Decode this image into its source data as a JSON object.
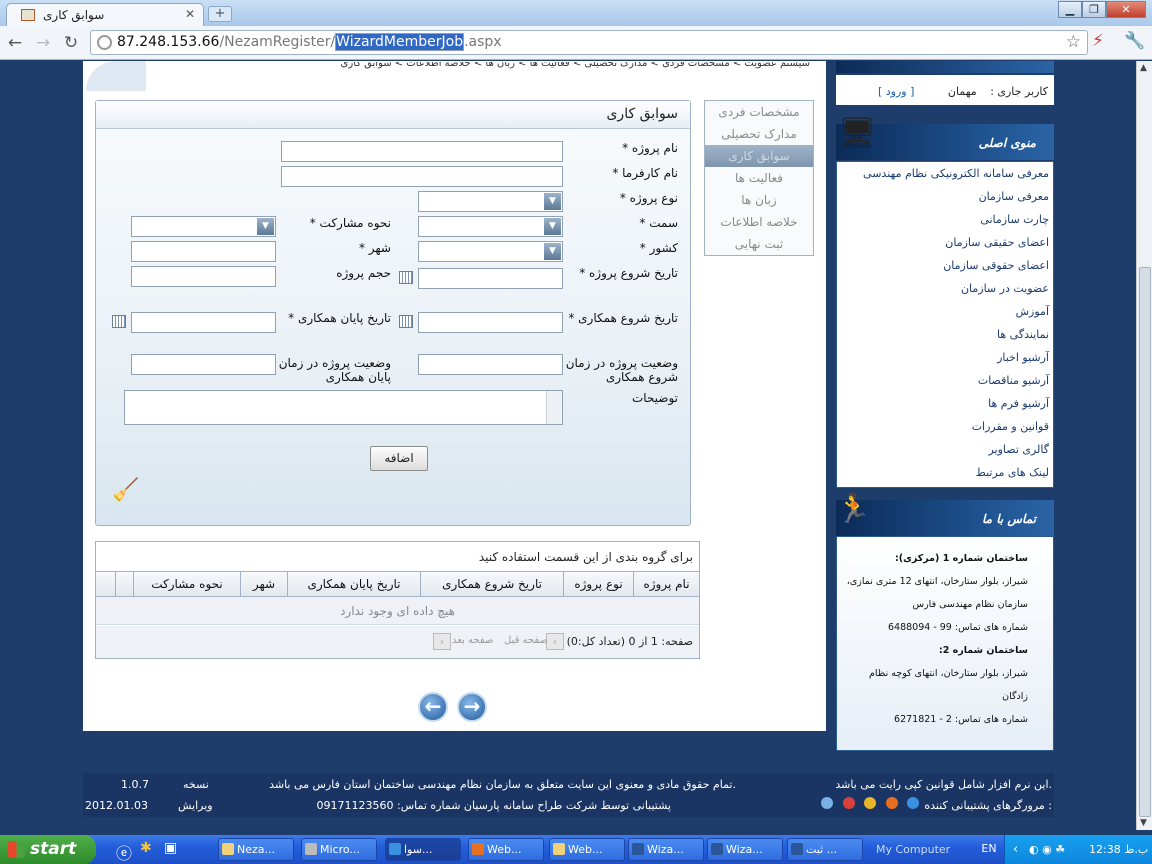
{
  "browser": {
    "tab_title": "سوابق کاری",
    "new_tab": "+",
    "url_host": "87.248.153.66",
    "url_path_pre": "/NezamRegister/",
    "url_selected": "WizardMemberJob",
    "url_ext": ".aspx",
    "win_min": "▁",
    "win_max": "❐",
    "win_close": "✕"
  },
  "breadcrumb": "سیستم عضویت > مشخصات فردی > مدارک تحصیلی > فعالیت ها > زبان ها > خلاصه اطلاعات > سوابق کاری",
  "wizard_steps": [
    "مشخصات فردی",
    "مدارک تحصیلی",
    "سوابق کاری",
    "فعالیت ها",
    "زبان ها",
    "خلاصه اطلاعات",
    "ثبت نهایی"
  ],
  "form": {
    "title": "سوابق کاری",
    "project_name": "نام پروژه *",
    "employer_name": "نام کارفرما *",
    "project_type": "نوع پروژه *",
    "position": "سمت *",
    "participation": "نحوه مشارکت *",
    "country": "کشور *",
    "city": "شهر *",
    "project_start": "تاریخ شروع پروژه *",
    "project_volume": "حجم پروژه",
    "coop_start": "تاریخ شروع همکاری *",
    "coop_end": "تاریخ پایان همکاری *",
    "status_start_1": "وضعیت پروژه در زمان",
    "status_start_2": "شروع همکاری",
    "status_end_1": "وضعیت پروژه در زمان",
    "status_end_2": "پایان همکاری",
    "description": "توضیحات",
    "add_button": "اضافه"
  },
  "grid": {
    "group_hint": "برای گروه بندی از این قسمت استفاده کنید",
    "columns": [
      "نام پروژه",
      "نوع پروژه",
      "تاریخ شروع همکاری",
      "تاریخ پایان همکاری",
      "شهر",
      "نحوه مشارکت"
    ],
    "no_data": "هیچ داده ای وجود ندارد",
    "pager_info": "صفحه: 1 از 0 (تعداد کل:0)",
    "prev_page": "صفحه قبل",
    "next_page": "صفحه بعد"
  },
  "user": {
    "label": "کاربر جاری :",
    "name": "مهمان",
    "login": "ورود"
  },
  "main_menu": {
    "title": "منوی اصلی",
    "items": [
      "معرفی سامانه الکترونیکی نظام مهندسی",
      "معرفی سازمان",
      "چارت سازمانی",
      "اعضای حقیقی سازمان",
      "اعضای حقوقی سازمان",
      "عضویت در سازمان",
      "آموزش",
      "نمایندگی ها",
      "آرشیو اخبار",
      "آرشیو مناقصات",
      "آرشیو فرم ها",
      "قوانین و مقررات",
      "گالری تصاویر",
      "لینک های مرتبط"
    ]
  },
  "contact": {
    "title": "تماس با ما",
    "b1_title": "ساختمان شماره 1 (مرکزی):",
    "b1_addr": "شیراز، بلوار ستارخان، انتهای 12 متری نمازی،",
    "b1_org": "سازمان نظام مهندسی فارس",
    "b1_phone": "شماره های تماس: 99 - 6488094",
    "b2_title": "ساختمان شماره 2:",
    "b2_addr": "شیراز، بلوار ستارخان، انتهای کوچه نظام زادگان",
    "b2_phone": "شماره های تماس: 2 - 6271821"
  },
  "footer": {
    "line1_right": "این نرم افزار شامل قوانین کپی رایت می باشد.",
    "line1_center": "تمام حقوق مادی و معنوی این سایت متعلق به سازمان نظام مهندسی ساختمان استان فارس می باشد.",
    "version_label": "نسخه",
    "version": "1.0.7",
    "line2_right": "مرورگرهای پشتیبانی کننده :",
    "line2_center": "پشتیبانی توسط   شرکت طراح سامانه پارسیان شماره تماس: 09171123560",
    "edit_label": "ویرایش",
    "edit_date": "2012.01.03"
  },
  "taskbar": {
    "start": "start",
    "items": [
      "Neza...",
      "Micro...",
      "سوا...",
      "Web...",
      "Web...",
      "Wiza...",
      "Wiza...",
      "ثبت ..."
    ],
    "my_computer": "My Computer",
    "lang": "EN",
    "clock": "12:38 ب.ظ"
  }
}
